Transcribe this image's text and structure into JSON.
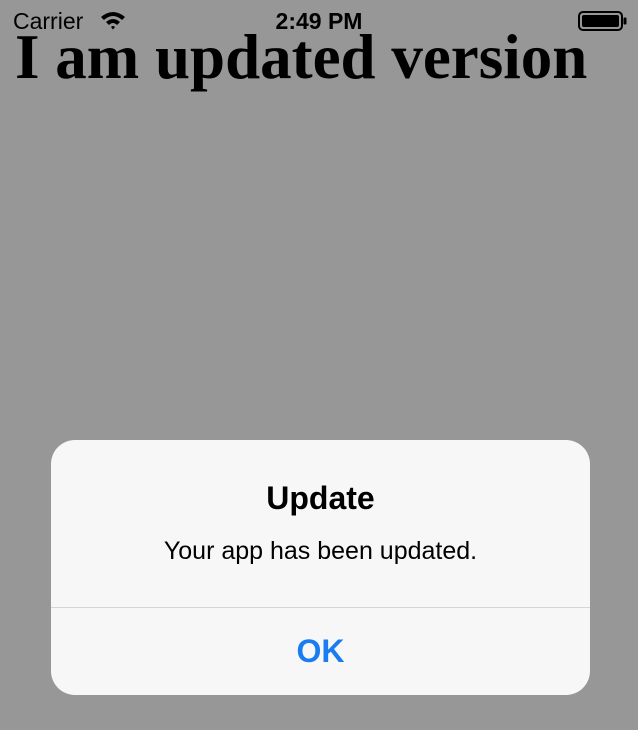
{
  "status_bar": {
    "carrier": "Carrier",
    "time": "2:49 PM",
    "wifi_icon": "wifi-icon",
    "battery_icon": "battery-icon"
  },
  "page": {
    "heading": "I am updated version",
    "background_color": "#979797"
  },
  "alert": {
    "title": "Update",
    "message": "Your app has been updated.",
    "ok_label": "OK",
    "accent_color": "#1a7cf0"
  }
}
